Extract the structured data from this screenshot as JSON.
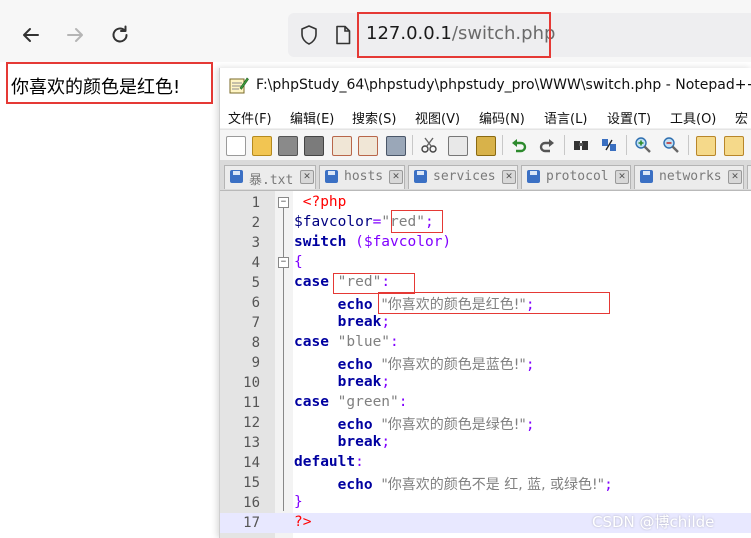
{
  "browser": {
    "url_host": "127.0.0.1",
    "url_path": "/switch.php"
  },
  "page_output": "你喜欢的颜色是红色!",
  "notepad": {
    "title": "F:\\phpStudy_64\\phpstudy\\phpstudy_pro\\WWW\\switch.php - Notepad++",
    "menu": [
      "文件(F)",
      "编辑(E)",
      "搜索(S)",
      "视图(V)",
      "编码(N)",
      "语言(L)",
      "设置(T)",
      "工具(O)",
      "宏"
    ],
    "tabs": [
      "暴.txt",
      "hosts",
      "services",
      "protocol",
      "networks"
    ],
    "line_numbers": [
      "1",
      "2",
      "3",
      "4",
      "5",
      "6",
      "7",
      "8",
      "9",
      "10",
      "11",
      "12",
      "13",
      "14",
      "15",
      "16",
      "17"
    ],
    "code": {
      "l1_tag": "<?php",
      "l2_var": "$favcolor",
      "l2_eq": "=",
      "l2_str": "\"red\"",
      "l2_semi": ";",
      "l3_kw": "switch",
      "l3_rest": " ($favcolor)",
      "l4": "{",
      "l5_kw": "case",
      "l5_str": "\"red\"",
      "l5_colon": ":",
      "l6_kw": "echo",
      "l6_str": "\"你喜欢的颜色是红色!\"",
      "l6_semi": ";",
      "l7_kw": "break",
      "l7_semi": ";",
      "l8_kw": "case",
      "l8_str": "\"blue\"",
      "l8_colon": ":",
      "l9_kw": "echo",
      "l9_str": "\"你喜欢的颜色是蓝色!\"",
      "l9_semi": ";",
      "l10_kw": "break",
      "l10_semi": ";",
      "l11_kw": "case",
      "l11_str": "\"green\"",
      "l11_colon": ":",
      "l12_kw": "echo",
      "l12_str": "\"你喜欢的颜色是绿色!\"",
      "l12_semi": ";",
      "l13_kw": "break",
      "l13_semi": ";",
      "l14_kw": "default",
      "l14_colon": ":",
      "l15_kw": "echo",
      "l15_str": "\"你喜欢的颜色不是 红, 蓝, 或绿色!\"",
      "l15_semi": ";",
      "l16": "}",
      "l17_tag": "?>"
    }
  },
  "watermark": "CSDN @博childe",
  "colors": {
    "highlight_box": "#e53935",
    "keyword": "#0000a0",
    "string": "#808080",
    "php_tag": "#ff0000",
    "operator": "#8000ff"
  }
}
